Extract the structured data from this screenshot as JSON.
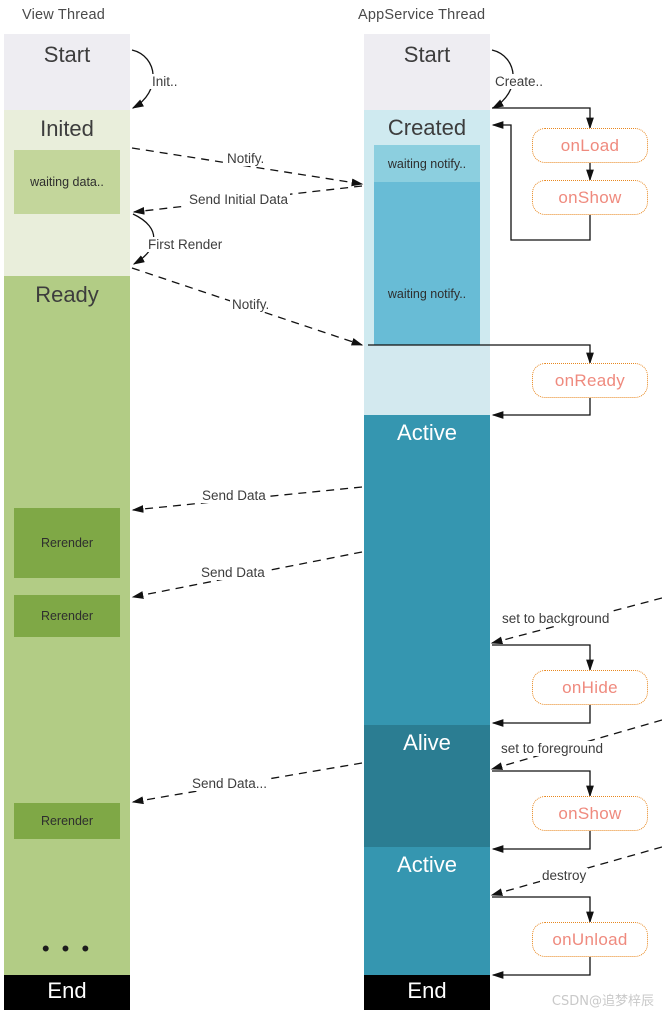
{
  "headers": {
    "left": "View Thread",
    "right": "AppService Thread"
  },
  "colors": {
    "start": "#eeedf2",
    "inited": "#e9eedb",
    "waiting_data": "#c3d69b",
    "ready": "#b2cc85",
    "rerender": "#7fa846",
    "end": "#000000",
    "created": "#cfeaf0",
    "waiting_notify_light": "#8ccfdf",
    "waiting_notify_dark": "#68bcd6",
    "ready_band": "#d3e9ef",
    "active": "#3596b0",
    "alive": "#2b7d92",
    "callback_border": "#e8871e",
    "callback_text": "#ef8a7e"
  },
  "view_thread": {
    "bands": [
      {
        "label": "Start",
        "size": "large"
      },
      {
        "label": "Inited",
        "size": "large"
      },
      {
        "label": "Ready",
        "size": "large"
      },
      {
        "label": "End",
        "size": "large"
      }
    ],
    "sub_blocks": [
      {
        "label": "waiting data.."
      },
      {
        "label": "Rerender"
      },
      {
        "label": "Rerender"
      },
      {
        "label": "Rerender"
      }
    ],
    "ellipsis": "• • •"
  },
  "appservice_thread": {
    "bands": [
      {
        "label": "Start"
      },
      {
        "label": "Created"
      },
      {
        "label": "Active"
      },
      {
        "label": "Alive"
      },
      {
        "label": "Active"
      },
      {
        "label": "End"
      }
    ],
    "sub_blocks": [
      {
        "label": "waiting notify.."
      },
      {
        "label": "waiting notify.."
      }
    ]
  },
  "callbacks": [
    {
      "label": "onLoad"
    },
    {
      "label": "onShow"
    },
    {
      "label": "onReady"
    },
    {
      "label": "onHide"
    },
    {
      "label": "onShow"
    },
    {
      "label": "onUnload"
    }
  ],
  "edges": [
    {
      "label": "Init..",
      "kind": "solid-curve"
    },
    {
      "label": "Create..",
      "kind": "solid-curve"
    },
    {
      "label": "Notify.",
      "kind": "dashed"
    },
    {
      "label": "Send Initial Data",
      "kind": "dashed"
    },
    {
      "label": "First Render",
      "kind": "solid-curve"
    },
    {
      "label": "Notify.",
      "kind": "dashed"
    },
    {
      "label": "Send Data",
      "kind": "dashed"
    },
    {
      "label": "Send Data",
      "kind": "dashed"
    },
    {
      "label": "set to background",
      "kind": "dashed"
    },
    {
      "label": "Send Data...",
      "kind": "dashed"
    },
    {
      "label": "set to foreground",
      "kind": "dashed"
    },
    {
      "label": "destroy",
      "kind": "dashed"
    }
  ],
  "watermark": "CSDN@追梦梓辰"
}
